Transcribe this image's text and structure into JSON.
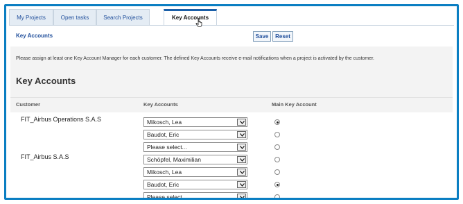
{
  "tabs": [
    "My Projects",
    "Open tasks",
    "Search Projects",
    "Key Accounts"
  ],
  "panel_title": "Key Accounts",
  "buttons": {
    "save": "Save",
    "reset": "Reset"
  },
  "info_text": "Please assign at least one Key Account Manager for each customer. The defined Key Accounts receive e-mail notifications when a project is activated by the customer.",
  "section_title": "Key Accounts",
  "columns": {
    "customer": "Customer",
    "key_accounts": "Key Accounts",
    "main": "Main Key Account"
  },
  "customers": [
    "FIT_Airbus Operations S.A.S",
    "FIT_Airbus S.A.S"
  ],
  "rows": [
    {
      "value": "Mikosch, Lea",
      "main": true
    },
    {
      "value": "Baudot, Eric",
      "main": false
    },
    {
      "value": "Please select...",
      "main": false
    },
    {
      "value": "Schöpfel, Maximilian",
      "main": false
    },
    {
      "value": "Mikosch, Lea",
      "main": false
    },
    {
      "value": "Baudot, Eric",
      "main": true
    },
    {
      "value": "Please select...",
      "main": false
    }
  ],
  "colors": {
    "accent": "#0a7ec2",
    "link": "#1f4e9b"
  },
  "icons": {
    "dropdown": "chevron-down-icon",
    "cursor": "hand-pointer-icon"
  }
}
